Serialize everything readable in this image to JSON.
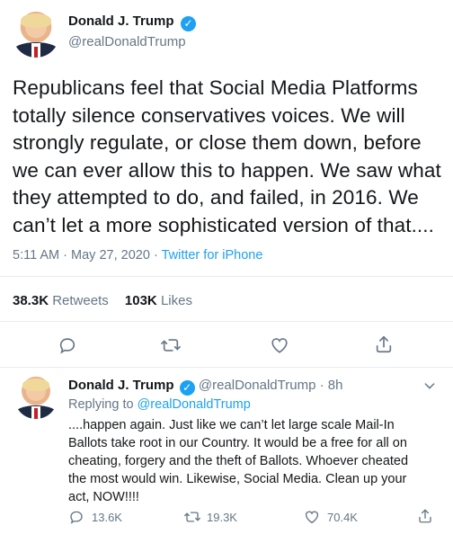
{
  "main_tweet": {
    "author_name": "Donald J. Trump",
    "handle": "@realDonaldTrump",
    "text": "Republicans feel that Social Media Platforms totally silence conservatives voices. We will strongly regulate, or close them down, before we can ever allow this to happen. We saw what they attempted to do, and failed, in 2016. We can’t let a more sophisticated version of that....",
    "lines": [
      "Republicans feel that Social Media Platforms",
      "totally silence conservatives voices. We will",
      "strongly regulate, or close them down, before",
      "we can ever allow this to happen. We saw what",
      "they attempted to do, and failed, in 2016. We",
      "can’t let a more sophisticated version of that...."
    ],
    "time": "5:11 AM",
    "date": "May 27, 2020",
    "separator": "·",
    "source": "Twitter for iPhone",
    "retweets_count": "38.3K",
    "retweets_label": "Retweets",
    "likes_count": "103K",
    "likes_label": "Likes"
  },
  "reply_tweet": {
    "author_name": "Donald J. Trump",
    "handle": "@realDonaldTrump",
    "age": "8h",
    "separator": "·",
    "replying_prefix": "Replying to",
    "replying_to": "@realDonaldTrump",
    "lines": [
      "....happen again. Just like we can’t let large scale Mail-In",
      "Ballots take root in our Country. It would be a free for all on",
      "cheating, forgery and the theft of Ballots. Whoever cheated",
      "the most would win. Likewise, Social Media. Clean up your",
      "act, NOW!!!!"
    ],
    "reply_count": "13.6K",
    "retweet_count": "19.3K",
    "like_count": "70.4K"
  },
  "icons": {
    "verified": "verified-badge-icon",
    "reply": "reply-icon",
    "retweet": "retweet-icon",
    "like": "like-icon",
    "share": "share-icon",
    "more": "more-icon"
  },
  "colors": {
    "accent": "#1da1f2",
    "text": "#14171a",
    "muted": "#657786",
    "divider": "#e6ecf0"
  }
}
